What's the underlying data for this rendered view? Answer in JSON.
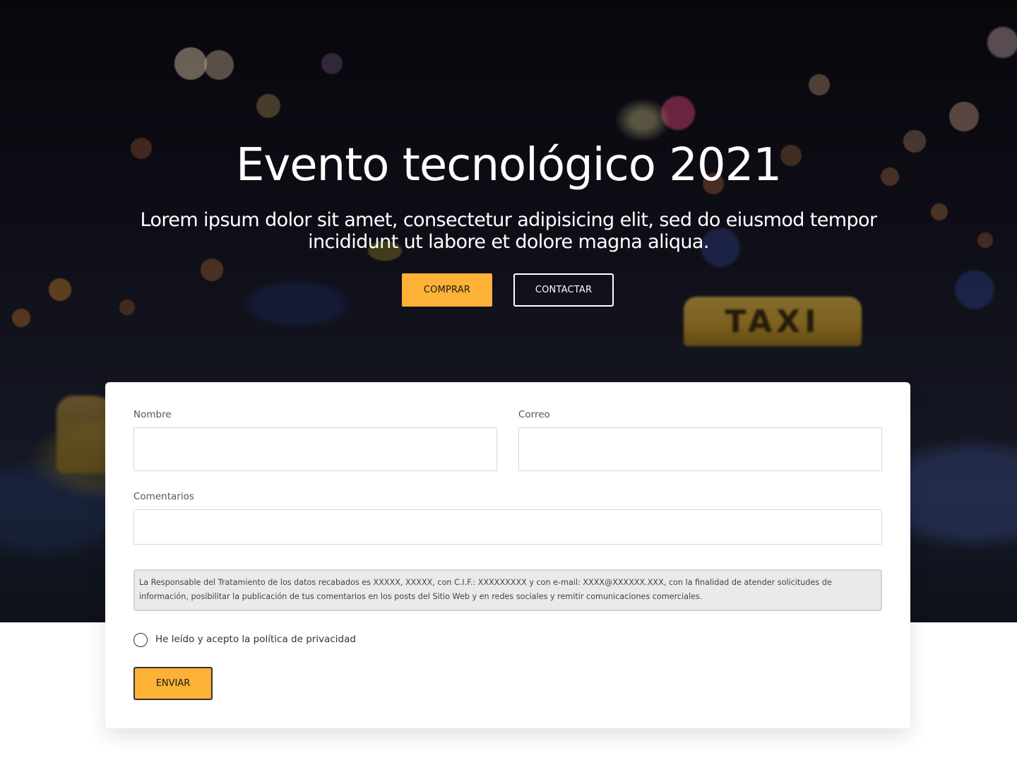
{
  "hero": {
    "title": "Evento tecnológico 2021",
    "subtitle": "Lorem ipsum dolor sit amet, consectetur adipisicing elit, sed do eiusmod tempor incididunt ut labore et dolore magna aliqua.",
    "buy_label": "COMPRAR",
    "contact_label": "CONTACTAR",
    "background_sign_text": "TAXI"
  },
  "form": {
    "name_label": "Nombre",
    "name_value": "",
    "email_label": "Correo",
    "email_value": "",
    "comments_label": "Comentarios",
    "comments_value": "",
    "legal_text": "La Responsable del Tratamiento de los datos recabados es XXXXX, XXXXX, con C.I.F.: XXXXXXXXX y con e-mail: XXXX@XXXXXX.XXX, con la finalidad de atender solicitudes de información, posibilitar la publicación de tus comentarios en los posts del Sitio Web y en redes sociales y remitir comunicaciones comerciales.",
    "privacy_label": "He leído y acepto la política de privacidad",
    "privacy_checked": false,
    "submit_label": "ENVIAR"
  },
  "colors": {
    "accent": "#fdb136",
    "text_dark": "#1a1a1a",
    "legal_bg": "#eaeaea"
  }
}
